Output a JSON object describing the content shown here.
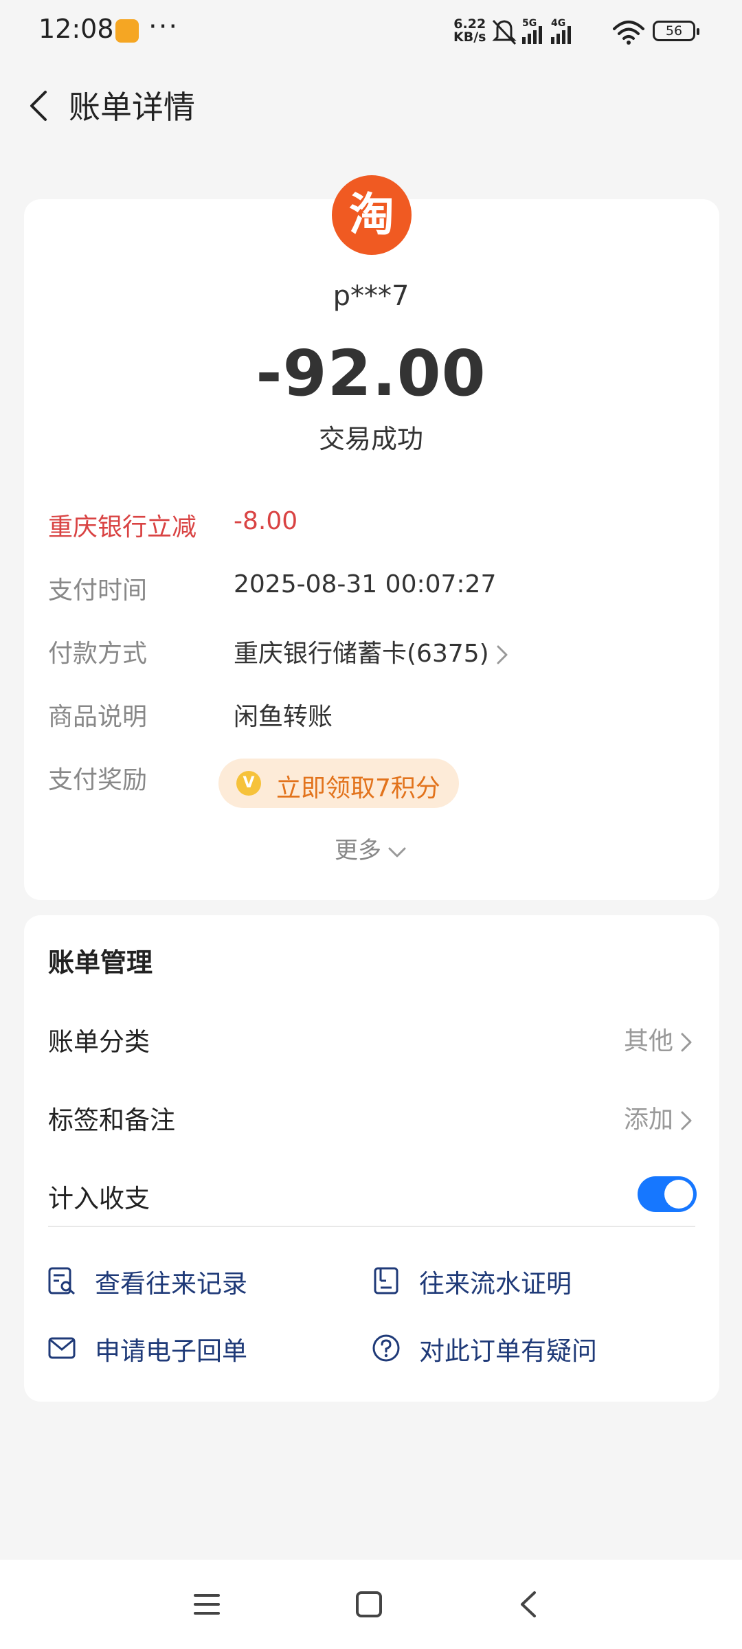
{
  "status_bar": {
    "time": "12:08",
    "more_dots": "···",
    "net_speed_value": "6.22",
    "net_speed_unit": "KB/s",
    "signal_5g": "5G",
    "signal_4g": "4G",
    "battery": "56"
  },
  "header": {
    "title": "账单详情",
    "back_icon": "chevron-left-icon"
  },
  "transaction": {
    "merchant_logo_text": "淘",
    "merchant_logo_color": "#f05a22",
    "merchant_name": "p***7",
    "amount": "-92.00",
    "status": "交易成功"
  },
  "details": {
    "discount_label": "重庆银行立减",
    "discount_value": "-8.00",
    "pay_time_label": "支付时间",
    "pay_time_value": "2025-08-31 00:07:27",
    "pay_method_label": "付款方式",
    "pay_method_value": "重庆银行储蓄卡(6375)",
    "product_label": "商品说明",
    "product_value": "闲鱼转账",
    "reward_label": "支付奖励",
    "reward_coin": "V",
    "reward_button": "立即领取7积分",
    "more": "更多"
  },
  "management": {
    "title": "账单管理",
    "category_label": "账单分类",
    "category_value": "其他",
    "tags_label": "标签和备注",
    "tags_value": "添加",
    "count_label": "计入收支",
    "count_enabled": true,
    "links": {
      "history": "查看往来记录",
      "statement": "往来流水证明",
      "receipt": "申请电子回单",
      "question": "对此订单有疑问"
    }
  },
  "colors": {
    "accent": "#1677ff",
    "discount_red": "#d94343",
    "reward_orange": "#e2731c",
    "link_blue": "#1f3a78"
  }
}
